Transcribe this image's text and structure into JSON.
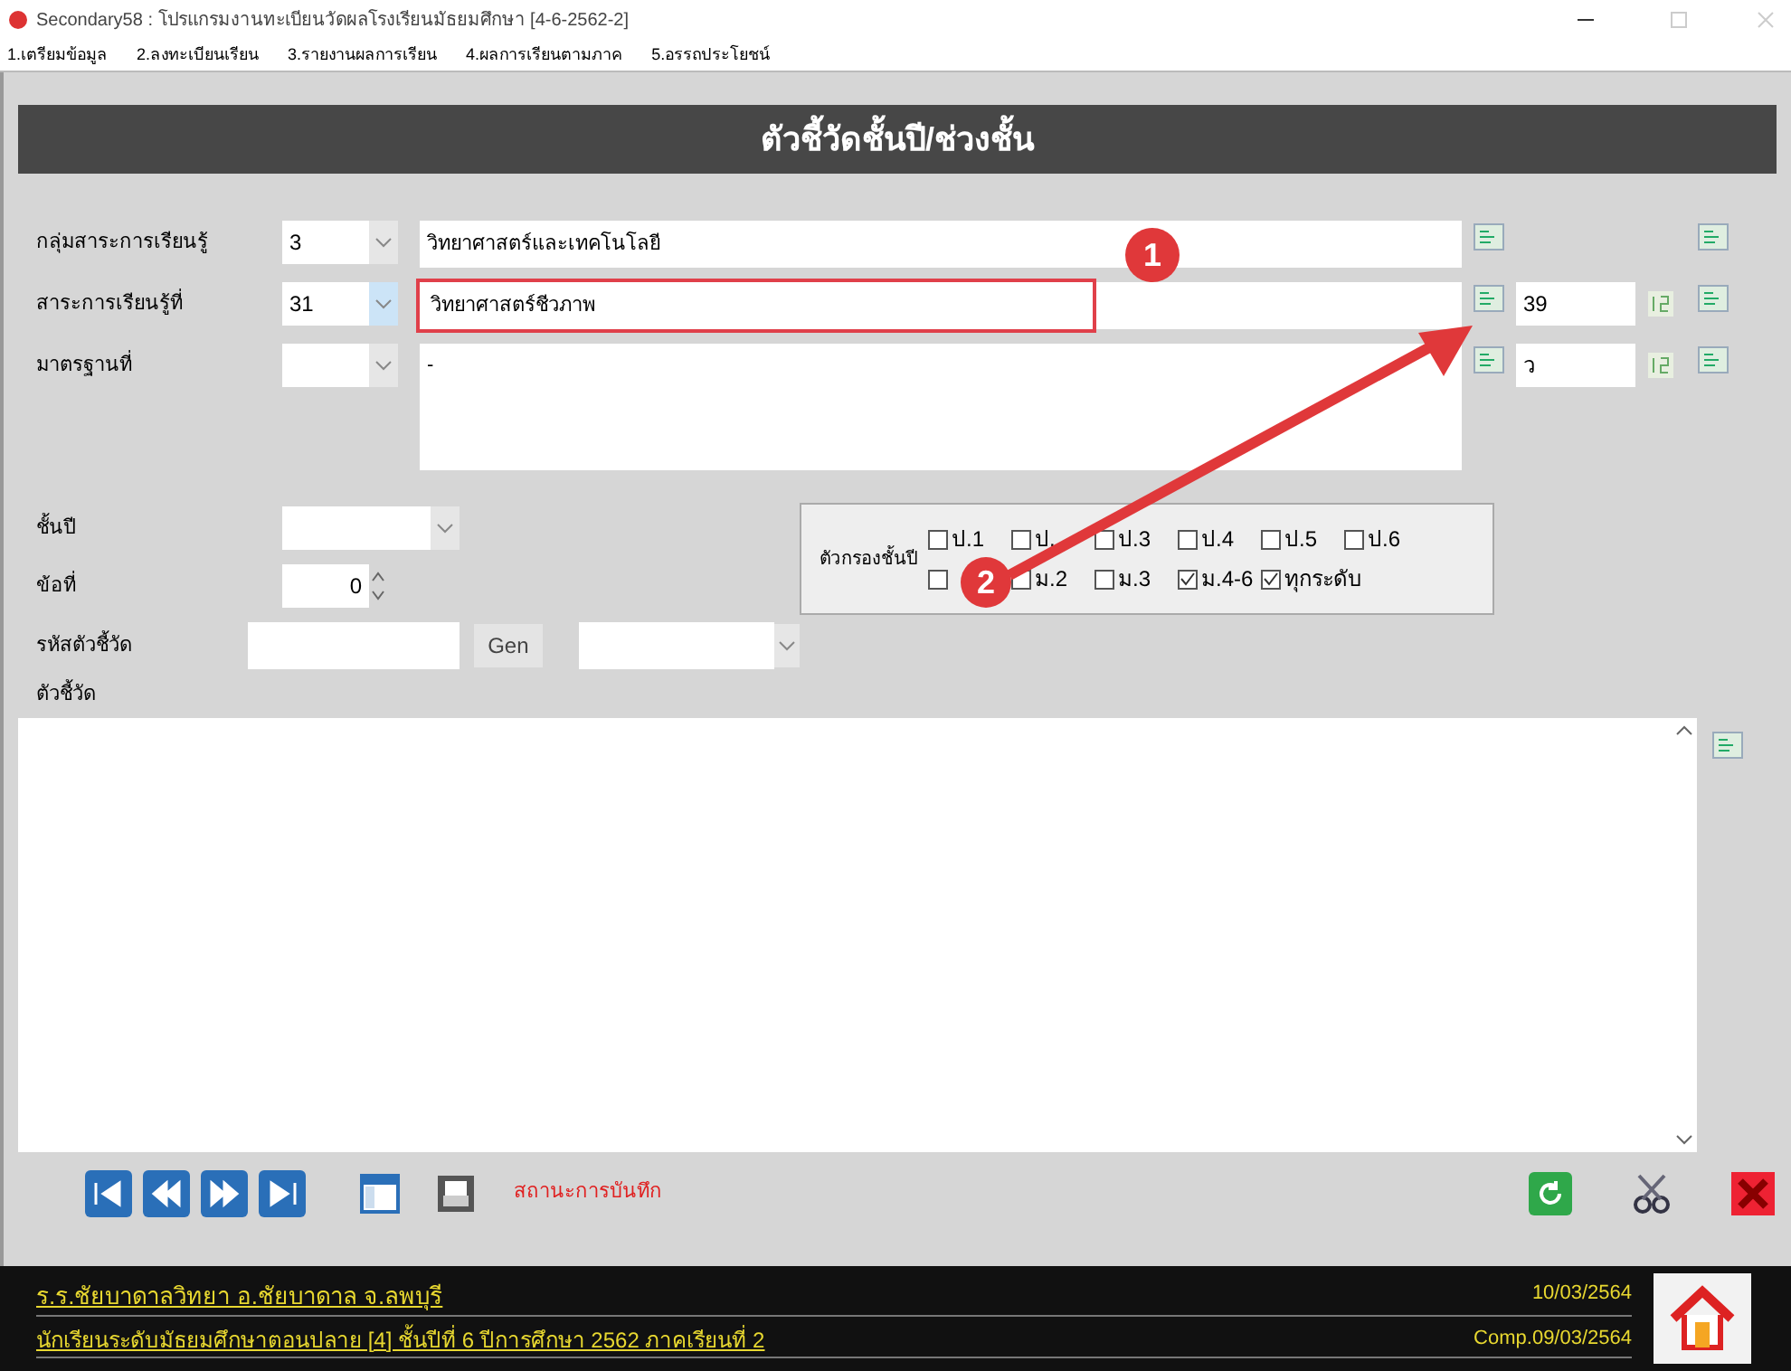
{
  "window": {
    "title": "Secondary58 : โปรแกรมงานทะเบียนวัดผลโรงเรียนมัธยมศึกษา [4-6-2562-2]"
  },
  "menu": [
    "1.เตรียมข้อมูล",
    "2.ลงทะเบียนเรียน",
    "3.รายงานผลการเรียน",
    "4.ผลการเรียนตามภาค",
    "5.อรรถประโยชน์"
  ],
  "header": "ตัวชี้วัดชั้นปี/ช่วงชั้น",
  "rows": [
    {
      "label": "กลุ่มสาระการเรียนรู้",
      "code": "3",
      "text": "วิทยาศาสตร์และเทคโนโลยี",
      "highlighted": false,
      "extra": null
    },
    {
      "label": "สาระการเรียนรู้ที่",
      "code": "31",
      "text": "วิทยาศาสตร์ชีวภาพ",
      "highlighted": true,
      "extra": "39"
    },
    {
      "label": "มาตรฐานที่",
      "code": "",
      "text": "-",
      "highlighted": false,
      "extra": "ว"
    }
  ],
  "grade": {
    "label": "ชั้นปี"
  },
  "item_no": {
    "label": "ข้อที่",
    "value": "0"
  },
  "indicator_code": {
    "label": "รหัสตัวชี้วัด",
    "button": "Gen"
  },
  "filter": {
    "label": "ตัวกรองชั้นปี",
    "options": [
      {
        "label": "ป.1",
        "checked": false
      },
      {
        "label": "ป.",
        "checked": false
      },
      {
        "label": "ป.3",
        "checked": false
      },
      {
        "label": "ป.4",
        "checked": false
      },
      {
        "label": "ป.5",
        "checked": false
      },
      {
        "label": "ป.6",
        "checked": false
      },
      {
        "checked": false
      },
      {
        "label": "ม.2",
        "checked": false
      },
      {
        "label": "ม.3",
        "checked": false
      },
      {
        "label": "ม.4-6",
        "checked": true
      },
      {
        "label": "ทุกระดับ",
        "checked": true
      }
    ]
  },
  "indicator": {
    "label": "ตัวชี้วัด"
  },
  "status_text": "สถานะการบันทึก",
  "footer": {
    "school": "ร.ร.ชัยบาดาลวิทยา อ.ชัยบาดาล จ.ลพบุรี",
    "date": "10/03/2564",
    "info": "นักเรียนระดับมัธยมศึกษาตอนปลาย [4] ชั้นปีที่ 6 ปีการศึกษา 2562 ภาคเรียนที่ 2",
    "comp_date": "Comp.09/03/2564"
  },
  "callouts": [
    "1",
    "2"
  ]
}
